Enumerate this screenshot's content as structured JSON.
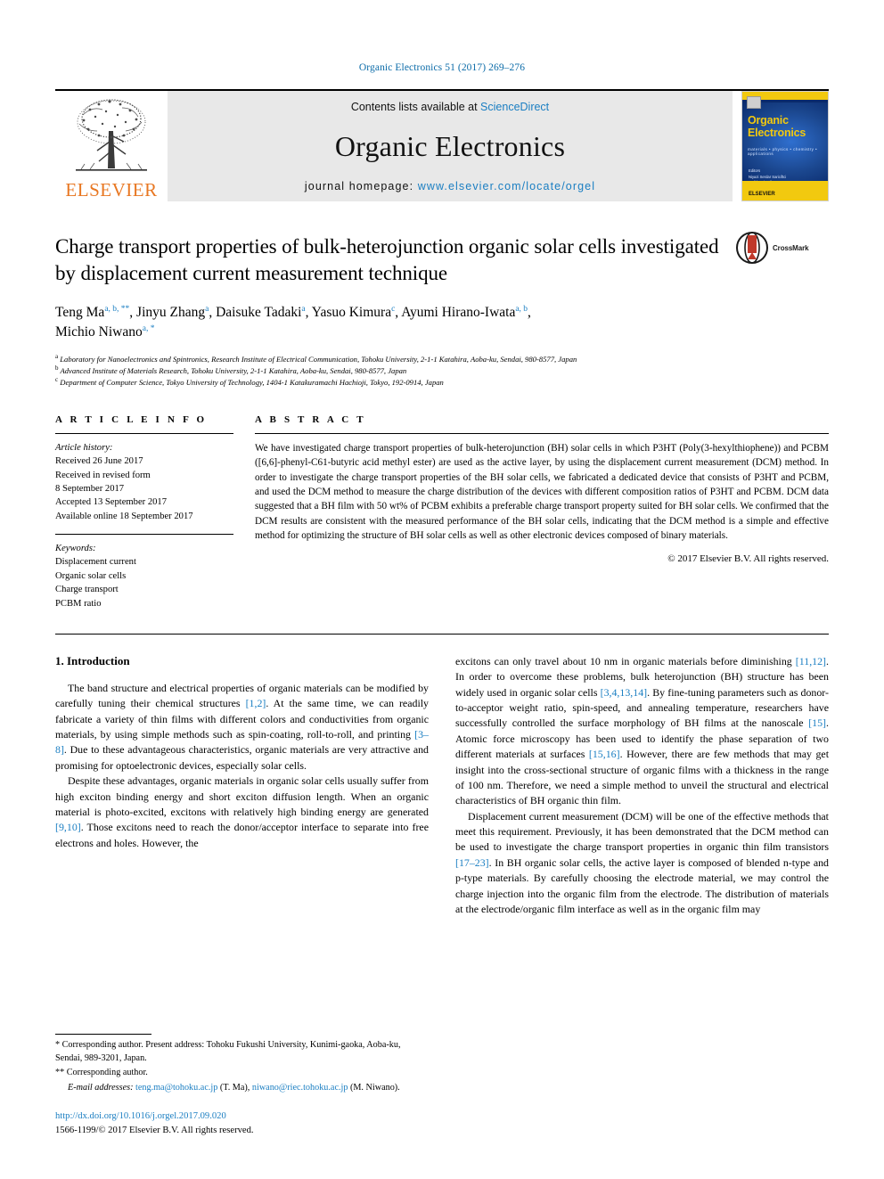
{
  "running_head": "Organic Electronics 51 (2017) 269–276",
  "masthead": {
    "publisher_name": "ELSEVIER",
    "contents_prefix": "Contents lists available at ",
    "contents_link": "ScienceDirect",
    "journal_name": "Organic Electronics",
    "homepage_prefix": "journal homepage: ",
    "homepage_url": "www.elsevier.com/locate/orgel",
    "cover": {
      "title_line1": "Organic",
      "title_line2": "Electronics",
      "subtitle": "materials • physics • chemistry • applications",
      "editors": "Editors\nNiyazi Serdar Sariciftci\nJudith Driscoll\nYong-Young Noh\nKarl Leo\nSeng-Tiong Ho",
      "bottom_logo": "ELSEVIER"
    }
  },
  "article": {
    "title": "Charge transport properties of bulk-heterojunction organic solar cells investigated by displacement current measurement technique",
    "crossmark_label": "CrossMark",
    "authors_line1_a": "Teng Ma",
    "authors_line1_a_sup": "a, b, **",
    "authors_line1_b": ", Jinyu Zhang",
    "authors_line1_b_sup": "a",
    "authors_line1_c": ", Daisuke Tadaki",
    "authors_line1_c_sup": "a",
    "authors_line1_d": ", Yasuo Kimura",
    "authors_line1_d_sup": "c",
    "authors_line1_e": ", Ayumi Hirano-Iwata",
    "authors_line1_e_sup": "a, b",
    "authors_line1_f": ",",
    "authors_line2_a": "Michio Niwano",
    "authors_line2_a_sup": "a, *",
    "affiliations": [
      {
        "marker": "a",
        "text": "Laboratory for Nanoelectronics and Spintronics, Research Institute of Electrical Communication, Tohoku University, 2-1-1 Katahira, Aoba-ku, Sendai, 980-8577, Japan"
      },
      {
        "marker": "b",
        "text": "Advanced Institute of Materials Research, Tohoku University, 2-1-1 Katahira, Aoba-ku, Sendai, 980-8577, Japan"
      },
      {
        "marker": "c",
        "text": "Department of Computer Science, Tokyo University of Technology, 1404-1 Katakuramachi Hachioji, Tokyo, 192-0914, Japan"
      }
    ]
  },
  "article_info": {
    "heading": "A R T I C L E   I N F O",
    "history_label": "Article history:",
    "history": [
      "Received 26 June 2017",
      "Received in revised form",
      "8 September 2017",
      "Accepted 13 September 2017",
      "Available online 18 September 2017"
    ],
    "keywords_label": "Keywords:",
    "keywords": [
      "Displacement current",
      "Organic solar cells",
      "Charge transport",
      "PCBM ratio"
    ]
  },
  "abstract": {
    "heading": "A B S T R A C T",
    "text": "We have investigated charge transport properties of bulk-heterojunction (BH) solar cells in which P3HT (Poly(3-hexylthiophene)) and PCBM ([6,6]-phenyl-C61-butyric acid methyl ester) are used as the active layer, by using the displacement current measurement (DCM) method. In order to investigate the charge transport properties of the BH solar cells, we fabricated a dedicated device that consists of P3HT and PCBM, and used the DCM method to measure the charge distribution of the devices with different composition ratios of P3HT and PCBM. DCM data suggested that a BH film with 50 wt% of PCBM exhibits a preferable charge transport property suited for BH solar cells. We confirmed that the DCM results are consistent with the measured performance of the BH solar cells, indicating that the DCM method is a simple and effective method for optimizing the structure of BH solar cells as well as other electronic devices composed of binary materials.",
    "copyright": "© 2017 Elsevier B.V. All rights reserved."
  },
  "body": {
    "section_title": "1. Introduction",
    "left_paragraph_1_part1": "The band structure and electrical properties of organic materials can be modified by carefully tuning their chemical structures ",
    "left_paragraph_1_ref1": "[1,2]",
    "left_paragraph_1_part2": ". At the same time, we can readily fabricate a variety of thin films with different colors and conductivities from organic materials, by using simple methods such as spin-coating, roll-to-roll, and printing ",
    "left_paragraph_1_ref2": "[3–8]",
    "left_paragraph_1_part3": ". Due to these advantageous characteristics, organic materials are very attractive and promising for optoelectronic devices, especially solar cells.",
    "left_paragraph_2_part1": "Despite these advantages, organic materials in organic solar cells usually suffer from high exciton binding energy and short exciton diffusion length. When an organic material is photo-excited, excitons with relatively high binding energy are generated ",
    "left_paragraph_2_ref1": "[9,10]",
    "left_paragraph_2_part2": ". Those excitons need to reach the donor/acceptor interface to separate into free electrons and holes. However, the",
    "right_paragraph_1_part1": "excitons can only travel about 10 nm in organic materials before diminishing ",
    "right_paragraph_1_ref1": "[11,12]",
    "right_paragraph_1_part2": ". In order to overcome these problems, bulk heterojunction (BH) structure has been widely used in organic solar cells ",
    "right_paragraph_1_ref2": "[3,4,13,14]",
    "right_paragraph_1_part3": ". By fine-tuning parameters such as donor-to-acceptor weight ratio, spin-speed, and annealing temperature, researchers have successfully controlled the surface morphology of BH films at the nanoscale ",
    "right_paragraph_1_ref3": "[15]",
    "right_paragraph_1_part4": ". Atomic force microscopy has been used to identify the phase separation of two different materials at surfaces ",
    "right_paragraph_1_ref4": "[15,16]",
    "right_paragraph_1_part5": ". However, there are few methods that may get insight into the cross-sectional structure of organic films with a thickness in the range of 100 nm. Therefore, we need a simple method to unveil the structural and electrical characteristics of BH organic thin film.",
    "right_paragraph_2_part1": "Displacement current measurement (DCM) will be one of the effective methods that meet this requirement. Previously, it has been demonstrated that the DCM method can be used to investigate the charge transport properties in organic thin film transistors ",
    "right_paragraph_2_ref1": "[17–23]",
    "right_paragraph_2_part2": ". In BH organic solar cells, the active layer is composed of blended n-type and p-type materials. By carefully choosing the electrode material, we may control the charge injection into the organic film from the electrode. The distribution of materials at the electrode/organic film interface as well as in the organic film may"
  },
  "footnotes": {
    "fn1": "* Corresponding author. Present address: Tohoku Fukushi University, Kunimi-gaoka, Aoba-ku, Sendai, 989-3201, Japan.",
    "fn2": "** Corresponding author.",
    "email_label": "E-mail addresses:",
    "email1": "teng.ma@tohoku.ac.jp",
    "email1_who": "(T. Ma),",
    "email2": "niwano@riec.tohoku.ac.jp",
    "email2_who": "(M. Niwano).",
    "doi": "http://dx.doi.org/10.1016/j.orgel.2017.09.020",
    "issn_line": "1566-1199/© 2017 Elsevier B.V. All rights reserved."
  },
  "colors": {
    "link": "#1a7ec2",
    "elsevier_orange": "#E87722",
    "cover_blue": "#0a2a6b",
    "cover_yellow": "#f2c90f"
  }
}
